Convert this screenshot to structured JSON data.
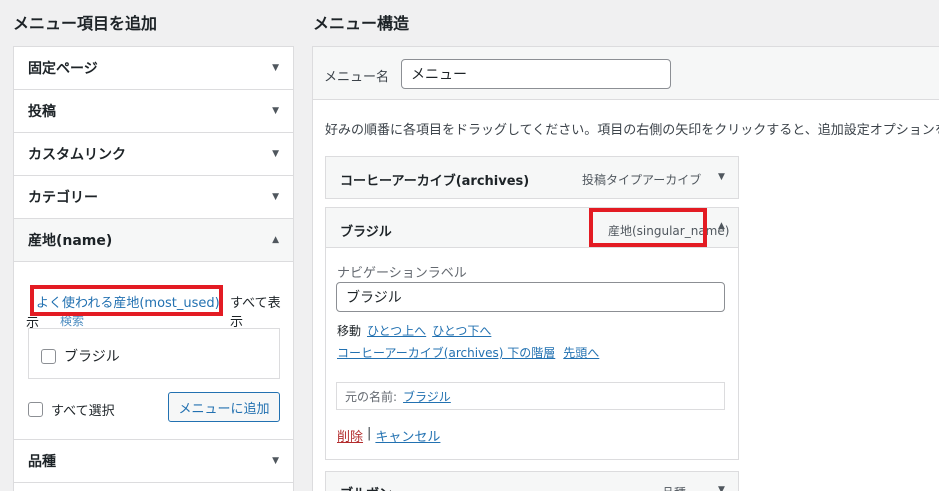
{
  "left": {
    "heading": "メニュー項目を追加",
    "sections": [
      {
        "label": "固定ページ"
      },
      {
        "label": "投稿"
      },
      {
        "label": "カスタムリンク"
      },
      {
        "label": "カテゴリー"
      },
      {
        "label": "産地(name)"
      },
      {
        "label": "品種"
      }
    ],
    "tabs": {
      "most_used": "よく使われる産地(most_used)",
      "view_all": "すべて表示",
      "view_all_wrap": "示",
      "search": "検索"
    },
    "terms": [
      {
        "label": "ブラジル"
      }
    ],
    "select_all": "すべて選択",
    "add_button": "メニューに追加"
  },
  "right": {
    "heading": "メニュー構造",
    "menu_name_label": "メニュー名",
    "menu_name_value": "メニュー",
    "instruction": "好みの順番に各項目をドラッグしてください。項目の右側の矢印をクリックすると、追加設定オプションを",
    "items": [
      {
        "title": "コーヒーアーカイブ(archives)",
        "type": "投稿タイプアーカイブ"
      },
      {
        "title": "ブラジル",
        "type": "産地(singular_name)"
      },
      {
        "title": "ブルボン",
        "type": "品種"
      }
    ],
    "edit": {
      "nav_label_caption": "ナビゲーションラベル",
      "nav_label_value": "ブラジル",
      "move_label": "移動",
      "move_up": "ひとつ上へ",
      "move_down": "ひとつ下へ",
      "under": "コーヒーアーカイブ(archives) 下の階層",
      "to_top": "先頭へ",
      "original_label": "元の名前:",
      "original_value": "ブラジル",
      "delete": "削除",
      "separator": "|",
      "cancel": "キャンセル"
    }
  },
  "colors": {
    "accent": "#2271b1",
    "highlight_red": "#e31b23",
    "delete_red": "#b32d2e"
  }
}
